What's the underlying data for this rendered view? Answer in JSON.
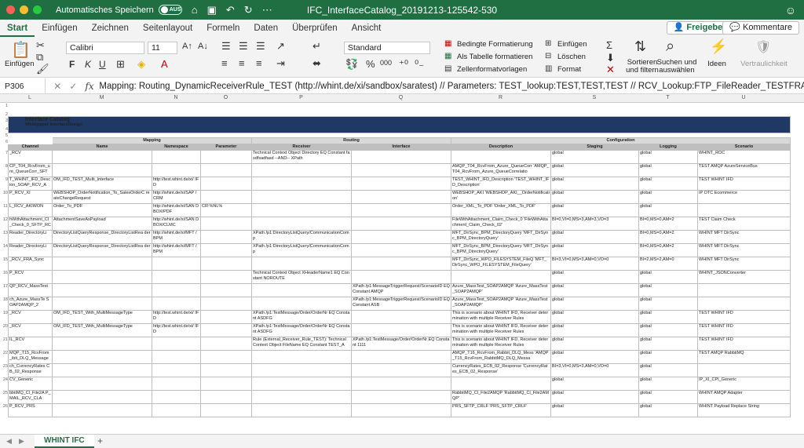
{
  "window": {
    "title": "IFC_InterfaceCatalog_20191213-125542-530",
    "autosave_label": "Automatisches Speichern",
    "autosave_state": "AUS"
  },
  "tabs": [
    "Start",
    "Einfügen",
    "Zeichnen",
    "Seitenlayout",
    "Formeln",
    "Daten",
    "Überprüfen",
    "Ansicht"
  ],
  "share_label": "Freigeben",
  "comments_label": "Kommentare",
  "ribbon": {
    "paste": "Einfügen",
    "font": "Calibri",
    "size": "11",
    "bold": "F",
    "italic": "K",
    "underline": "U",
    "number_format": "Standard",
    "cond_format": "Bedingte Formatierung",
    "as_table": "Als Tabelle formatieren",
    "cell_styles": "Zellenformatvorlagen",
    "insert": "Einfügen",
    "delete": "Löschen",
    "format": "Format",
    "sort": "Sortieren und filtern",
    "find": "Suchen und auswählen",
    "ideas": "Ideen",
    "sensitivity": "Vertraulichkeit",
    "percent": "%",
    "thousands": "000"
  },
  "formula": {
    "cell": "P306",
    "text": "Mapping: Routing_DynamicReceiverRule_TEST (http://whint.de/xi/sandbox/saratest) // Parameters: TEST_lookup:TEST,TEST,TEST  // RCV_Lookup:FTP_FileReader_TESTFRA_T04"
  },
  "columns": [
    "L",
    "M",
    "N",
    "O",
    "P",
    "Q",
    "R",
    "S",
    "T",
    "U"
  ],
  "row_numbers": [
    "1",
    "2",
    "3",
    "4",
    "5",
    "6",
    "7",
    "8",
    "9",
    "10",
    "11",
    "12",
    "13",
    "14",
    "15",
    "16",
    "17",
    "18",
    "19",
    "20",
    "21",
    "22",
    "23",
    "24",
    "25",
    "26"
  ],
  "sheet": {
    "title": "Interface Catalog",
    "subtitle": "Whitepaper InterfaceDesign",
    "groups": [
      "Mapping",
      "Routing",
      "Configuration"
    ],
    "headers": [
      "Channel",
      "Name",
      "Namespace",
      "Parameter",
      "Receiver",
      "Interface",
      "Description",
      "Staging",
      "Logging",
      "Scenario"
    ],
    "rows": [
      [
        "_RCV",
        "",
        "",
        "",
        "Technical Context Object  Directory EQ Constant fasdfsadfasd  --AND--  XPath",
        "",
        "",
        "global",
        "global",
        "WHINT_ROC"
      ],
      [
        "CP_T04_RcvFrom_ure_QueueCorr_SFT",
        "",
        "",
        "",
        "",
        "",
        "AMQP_T04_RcvFrom_Azure_QueueCorr 'AMQP_T04_RcvFrom_Azure_QueueCorrelatio",
        "global",
        "global",
        "TEST AMQP AzureServiceBus"
      ],
      [
        "T_WHINT_IFD_Desc ion_SOAP_RCV_A",
        "OM_IFD_TEST_Multi_Interface",
        "http://test.whint.de/xi/ IFD",
        "",
        "",
        "",
        "TEST_WHINT_IFD_Description 'TEST_WHINT_IFD_Description'",
        "global",
        "global",
        "TEST WHINT IFD"
      ],
      [
        "P_RCV_XI",
        "WEBSHOP_OrderNotification_To_SalesOrderC reateChangeRequest",
        "http://whint.de/xi/SAP /CRM",
        "",
        "",
        "",
        "WEBSHOP_AKI 'WEBSHOP_AKI__OrderNotification'",
        "global",
        "global",
        "IP OTC Ecommerce"
      ],
      [
        "L_RCV_AKIWON",
        "Order_To_PDF",
        "http://whint.de/xi/SAN DBOX/PDF",
        "CR:%NL%",
        "",
        "",
        "Order_XML_To_PDF 'Order_XML_To_PDF'",
        "global",
        "global",
        ""
      ],
      [
        "hWithAttachment_Cl _Check_0_SFTP_RC",
        "AttachmentSaveAsPayload",
        "http://whint.de/xi/SAN DBOX/CLMC",
        "",
        "",
        "",
        "FileWithAttachment_Claim_Check_0 'FileWithAttachment_Claim_Check_02'",
        "BI=0,VI=0,MS=3,AM=3,VO=3",
        "BI=0,MS=0,AM=2",
        "TEST Claim Check"
      ],
      [
        "Reader_DirectoryLi",
        "DirectoryListQueryResponse_DirectoryListRea der",
        "http://whint.de/xi/MFT /BPM",
        "",
        "XPath /p1:DirectoryListQuery/CommunicationComp",
        "",
        "MFT_DirSync_BPM_DirectoryQuery 'MFT_DirSync_BPM_DirectoryQuery'",
        "global",
        "BI=0,MS=0,AM=2",
        "WHINT MFT DirSync"
      ],
      [
        "Reader_DirectoryLi",
        "DirectoryListQueryResponse_DirectoryListRea der",
        "http://whint.de/xi/MFT /BPM",
        "",
        "XPath /p1:DirectoryListQuery/CommunicationComp",
        "",
        "MFT_DirSync_BPM_DirectoryQuery 'MFT_DirSync_BPM_DirectoryQuery'",
        "global",
        "BI=0,MS=0,AM=2",
        "WHINT MFT DirSync"
      ],
      [
        "_RCV_FRA_Sync",
        "",
        "",
        "",
        "",
        "",
        "MFT_DirSync_WPO_FILESYSTEM_FileQ 'MFT_DirSync_WPO_FILESYSTEM_FileQuery'",
        "BI=3,VI=0,MS=3,AM=0,VO=0",
        "BI=2,MS=2,AM=0",
        "WHINT MFT DirSync"
      ],
      [
        "P_RCV",
        "",
        "",
        "",
        "Technical Context Object  XHeaderName1 EQ Constant NOROUTE",
        "",
        "",
        "global",
        "global",
        "WHINT_JSONConverter"
      ],
      [
        "QP_RCV_MassTest",
        "",
        "",
        "",
        "",
        "XPath /p1:MessageTriggerRequest/ScenarioID EQ Constant AMQP",
        "Azure_MassTest_SOAP2AMQP 'Azure_MassTest_SOAP2AMQP'",
        "global",
        "global",
        ""
      ],
      [
        "ch_Azure_MassTe SOAP2AMQP_2",
        "",
        "",
        "",
        "",
        "XPath /p1:MessageTriggerRequest/ScenarioID EQ Constant ASB",
        "Azure_MassTest_SOAP2AMQP 'Azure_MassTest_SOAP2AMQP'",
        "global",
        "global",
        ""
      ],
      [
        "_RCV",
        "OM_IFD_TEST_With_MultiMessageType",
        "http://test.whint.de/xi/ IFD",
        "",
        "XPath /p1:TestMessage/Order/OrderNr EQ Constant ASDFG",
        "",
        "This is scenario about WHINT IFD, Receiver determination with multiple Receiver Rules",
        "global",
        "global",
        "TEST WHINT IFD"
      ],
      [
        "_RCV",
        "OM_IFD_TEST_With_MultiMessageType",
        "http://test.whint.de/xi/ IFD",
        "",
        "XPath /p1:TestMessage/Order/OrderNr EQ Constant ASDFG",
        "",
        "This is scenario about WHINT IFD, Receiver determination with multiple Receiver Rules",
        "global",
        "global",
        "TEST WHINT IFD"
      ],
      [
        "IL_RCV",
        "",
        "",
        "",
        "Rule (External_Receiver_Rule_TEST): Technical Context Object  FileName EQ Constant TEST_A",
        "XPath /p1:TestMessage/Order/OrderNr EQ Constant 1111",
        "This is scenario about WHINT IFD, Receiver determination with multiple Receiver Rules",
        "global",
        "global",
        "TEST WHINT IFD"
      ],
      [
        "MQP_T15_RcvFrom_ibit_DLQ_Message",
        "",
        "",
        "",
        "",
        "",
        "AMQP_T16_RcvFrom_Rabbit_DLQ_Mess 'AMQP_T15_RcvFrom_RabbitMQ_DLQ_Messa",
        "global",
        "global",
        "TEST AMQP RabbitMQ"
      ],
      [
        "ch_CurrencyRates CB_02_Response",
        "",
        "",
        "",
        "",
        "",
        "CurrencyRates_ECB_02_Response 'CurrencyRates_ECB_02_Response'",
        "BI=3,VI=0,MS=3,AM=0,VO=0",
        "global",
        ""
      ],
      [
        "CV_Generic",
        "",
        "",
        "",
        "",
        "",
        "",
        "global",
        "global",
        "IP_XI_CPI_Generic"
      ],
      [
        "bbitMQ_Cl_File2A P_MAIL_RCV_CLA",
        "",
        "",
        "",
        "",
        "",
        "RabbitMQ_Cl_File2AMQP 'RabbitMQ_Cl_File2AMQP'",
        "global",
        "global",
        "WHINT AMQP Adapter"
      ],
      [
        "P_RCV_PRS",
        "",
        "",
        "",
        "",
        "",
        "PRS_SFTP_CRLF 'PRS_SFTP_CRLF'",
        "global",
        "global",
        "WHINT Payload Replace String"
      ]
    ]
  },
  "sheet_tab": "WHINT IFC"
}
